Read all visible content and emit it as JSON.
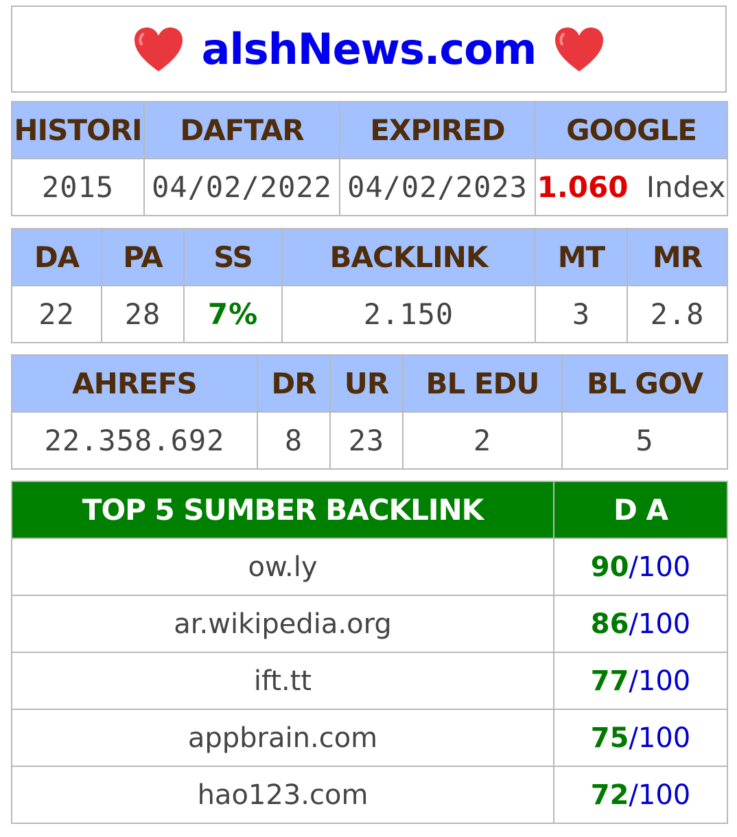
{
  "site": {
    "title": "alshNews.com"
  },
  "registration": {
    "headers": [
      "HISTORI",
      "DAFTAR",
      "EXPIRED",
      "GOOGLE"
    ],
    "histori": "2015",
    "daftar": "04/02/2022",
    "expired": "04/02/2023",
    "google_count": "1.060",
    "google_label": "Index"
  },
  "moz": {
    "headers": [
      "DA",
      "PA",
      "SS",
      "BACKLINK",
      "MT",
      "MR"
    ],
    "values": [
      "22",
      "28",
      "7%",
      "2.150",
      "3",
      "2.8"
    ]
  },
  "ahrefs": {
    "headers": [
      "AHREFS",
      "DR",
      "UR",
      "BL EDU",
      "BL GOV"
    ],
    "values": [
      "22.358.692",
      "8",
      "23",
      "2",
      "5"
    ]
  },
  "top_backlinks": {
    "header_source": "TOP 5 SUMBER BACKLINK",
    "header_da": "D A",
    "separator": "/",
    "max": "100",
    "rows": [
      {
        "domain": "ow.ly",
        "da": "90"
      },
      {
        "domain": "ar.wikipedia.org",
        "da": "86"
      },
      {
        "domain": "ift.tt",
        "da": "77"
      },
      {
        "domain": "appbrain.com",
        "da": "75"
      },
      {
        "domain": "hao123.com",
        "da": "72"
      }
    ]
  },
  "colors": {
    "header_bg": "#a4c1ff",
    "header_text": "#4f2d0a",
    "green_header_bg": "#008000",
    "title_blue": "#0000ee",
    "heart_red": "#e8383d"
  },
  "icons": {
    "title_left": "heart-icon",
    "title_right": "heart-icon"
  }
}
